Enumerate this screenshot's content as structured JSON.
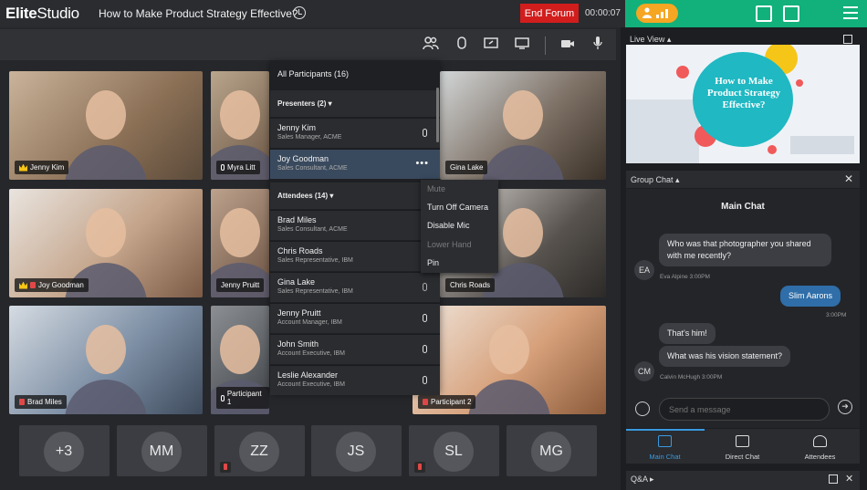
{
  "app": {
    "brand": "EliteStudio",
    "brand_bold": "Elite",
    "brand_light": "Studio",
    "session_title": "How to Make Product Strategy Effective?",
    "end_button": "End Forum",
    "timer": "00:00:07"
  },
  "colors": {
    "accent_green": "#12b07a",
    "end_red": "#d21d1d",
    "highlight_orange": "#f5a623",
    "link_blue": "#3a9ae0"
  },
  "toolbar_icons": [
    "participants-icon",
    "hand-icon",
    "share-screen-icon",
    "present-icon",
    "camera-icon",
    "mic-icon"
  ],
  "video_tiles": [
    {
      "name": "Jenny Kim",
      "badge": "crown",
      "muted": false
    },
    {
      "name": "Myra Litt",
      "badge": "mic",
      "muted": false
    },
    {
      "name": "Gina Lake",
      "badge": "",
      "muted": false
    },
    {
      "name": "Joy Goodman",
      "badge": "crown",
      "muted": true
    },
    {
      "name": "Jenny Pruitt",
      "badge": "",
      "muted": false
    },
    {
      "name": "Chris Roads",
      "badge": "",
      "muted": false
    },
    {
      "name": "Brad Miles",
      "badge": "",
      "muted": true
    },
    {
      "name": "Participant 1",
      "badge": "mic",
      "muted": false
    },
    {
      "name": "Participant 2",
      "badge": "",
      "muted": true
    }
  ],
  "bottom_participants": [
    {
      "initials": "+3",
      "muted": false
    },
    {
      "initials": "MM",
      "muted": false
    },
    {
      "initials": "ZZ",
      "muted": true
    },
    {
      "initials": "JS",
      "muted": false
    },
    {
      "initials": "SL",
      "muted": true
    },
    {
      "initials": "MG",
      "muted": false
    }
  ],
  "participants_panel": {
    "all_label": "All Participants (16)",
    "presenters_label": "Presenters (2)",
    "attendees_label": "Attendees (14)",
    "presenters": [
      {
        "name": "Jenny Kim",
        "role": "Sales Manager, ACME",
        "selected": false
      },
      {
        "name": "Joy Goodman",
        "role": "Sales Consultant, ACME",
        "selected": true
      }
    ],
    "attendees": [
      {
        "name": "Brad Miles",
        "role": "Sales Consultant, ACME"
      },
      {
        "name": "Chris Roads",
        "role": "Sales Representative, IBM"
      },
      {
        "name": "Gina Lake",
        "role": "Sales Representative, IBM"
      },
      {
        "name": "Jenny Pruitt",
        "role": "Account Manager, IBM"
      },
      {
        "name": "John Smith",
        "role": "Account Executive, IBM"
      },
      {
        "name": "Leslie Alexander",
        "role": "Account Executive, IBM"
      }
    ]
  },
  "context_menu": [
    {
      "label": "Mute",
      "disabled": true
    },
    {
      "label": "Turn Off Camera",
      "disabled": false
    },
    {
      "label": "Disable Mic",
      "disabled": false
    },
    {
      "label": "Lower Hand",
      "disabled": true
    },
    {
      "label": "Pin",
      "disabled": false
    }
  ],
  "live_view": {
    "label": "Live View",
    "slide_text": "How to Make Product Strategy Effective?"
  },
  "chat": {
    "section_label": "Group Chat",
    "title": "Main Chat",
    "messages": [
      {
        "text": "Who was that photographer you shared with me recently?",
        "from_me": false
      },
      {
        "meta": "Eva Alpine  3:00PM",
        "avatar": "EA"
      },
      {
        "text": "Slim Aarons",
        "from_me": true
      },
      {
        "meta": "3:00PM"
      },
      {
        "text": "That's him!",
        "from_me": false
      },
      {
        "text": "What was his vision statement?",
        "from_me": false
      },
      {
        "meta": "Calvin McHugh  3:00PM",
        "avatar": "CM"
      }
    ],
    "input_placeholder": "Send a message",
    "tabs": [
      {
        "label": "Main Chat",
        "active": true
      },
      {
        "label": "Direct Chat",
        "active": false
      },
      {
        "label": "Attendees",
        "active": false
      }
    ],
    "qa_label": "Q&A"
  }
}
